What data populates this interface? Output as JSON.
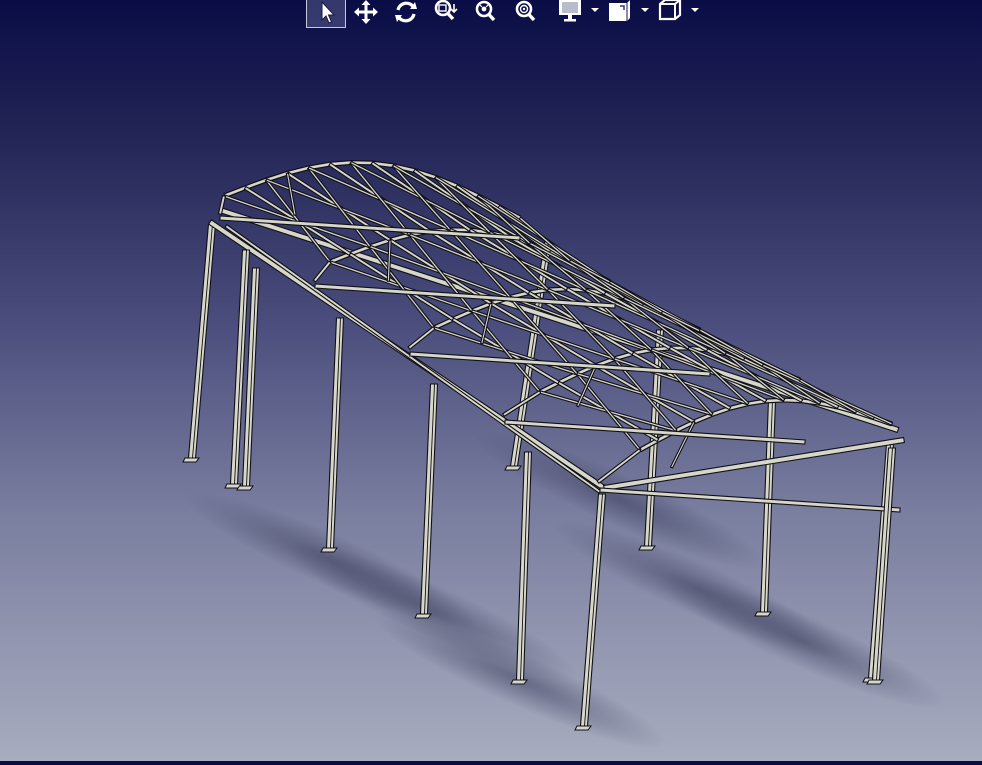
{
  "toolbar": {
    "buttons": [
      {
        "id": "select",
        "icon": "arrow-pointer-icon",
        "active": true
      },
      {
        "id": "pan",
        "icon": "pan-arrows-icon",
        "active": false
      },
      {
        "id": "rotate",
        "icon": "rotate-icon",
        "active": false
      },
      {
        "id": "fit-all",
        "icon": "fit-all-icon",
        "active": false
      },
      {
        "id": "zoom-in",
        "icon": "zoom-in-icon",
        "active": false
      },
      {
        "id": "zoom-out",
        "icon": "zoom-out-icon",
        "active": false
      },
      {
        "id": "view-mode",
        "icon": "monitor-icon",
        "active": false,
        "dropdown": true
      },
      {
        "id": "render-style",
        "icon": "render-style-icon",
        "active": false,
        "dropdown": true
      },
      {
        "id": "standard-views",
        "icon": "isometric-cube-icon",
        "active": false,
        "dropdown": true
      }
    ]
  },
  "colors": {
    "background_top": "#0a0c46",
    "background_bottom": "#a8acbf",
    "steel_fill": "#d6d6c9",
    "steel_edge": "#101018",
    "icon": "#ffffff"
  },
  "model": {
    "type": "steel-frame-structure",
    "columns_per_side": 5,
    "bays": 4,
    "roof": "curved-truss"
  }
}
